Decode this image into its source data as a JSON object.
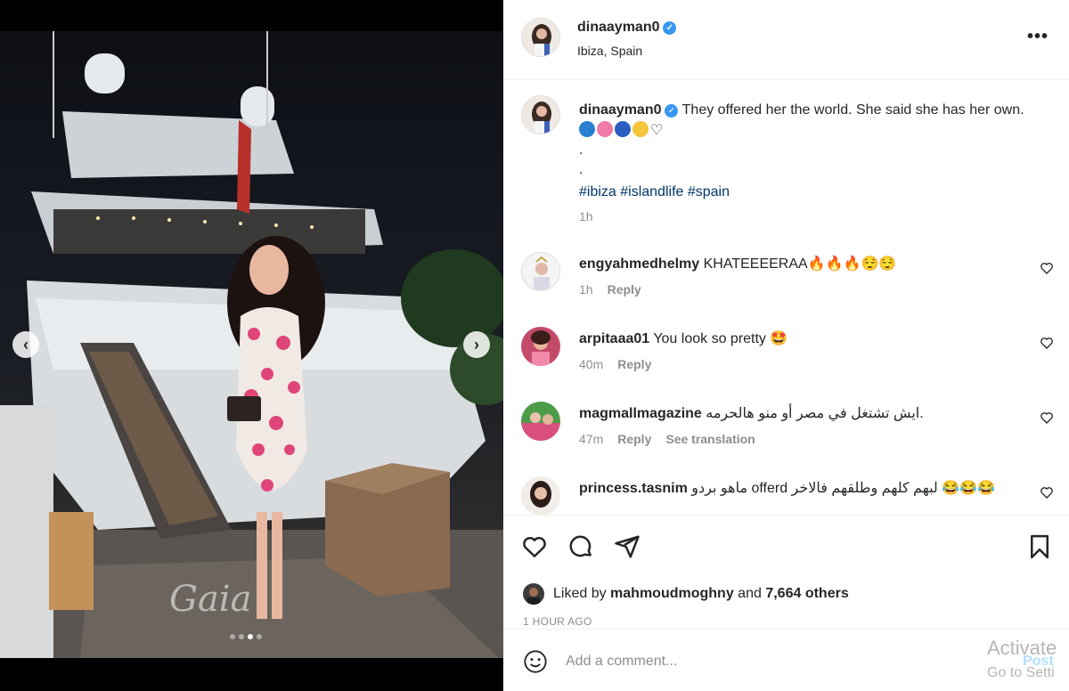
{
  "post": {
    "username": "dinaayman0",
    "location": "Ibiza, Spain",
    "more_label": "•••",
    "image_watermark": "Gaia"
  },
  "caption": {
    "username": "dinaayman0",
    "text": "They offered her the world. She said she has her own.",
    "dots": ".\n.",
    "hashtags": "#ibiza #islandlife #spain",
    "time": "1h"
  },
  "comments": [
    {
      "username": "engyahmedhelmy",
      "text": "KHATEEEERAA🔥🔥🔥😌😌",
      "time": "1h",
      "reply": "Reply",
      "translate": ""
    },
    {
      "username": "arpitaaa01",
      "text": "You look so pretty 🤩",
      "time": "40m",
      "reply": "Reply",
      "translate": ""
    },
    {
      "username": "magmallmagazine",
      "text": "ايش تشتغل في مصر أو منو هالحرمه.",
      "time": "47m",
      "reply": "Reply",
      "translate": "See translation"
    },
    {
      "username": "princess.tasnim",
      "text": "ماهو بردو offerd لبهم كلهم وطلقهم فالاخر 😂😂😂",
      "time": "",
      "reply": "",
      "translate": ""
    }
  ],
  "likes": {
    "prefix": "Liked by",
    "user": "mahmoudmoghny",
    "and": "and",
    "others": "7,664 others"
  },
  "timestamp": "1 HOUR AGO",
  "comment_box": {
    "placeholder": "Add a comment...",
    "post_label": "Post"
  },
  "watermark": {
    "line1": "Activate",
    "line2": "Go to Setti"
  },
  "carousel": {
    "slide_count": 4,
    "active_index": 2
  },
  "icons": [
    "chevron-left-icon",
    "chevron-right-icon",
    "more-icon",
    "verified-icon",
    "heart-icon",
    "comment-icon",
    "share-icon",
    "bookmark-icon",
    "emoji-icon"
  ],
  "colors": {
    "link": "#00376b",
    "verified": "#3897f0",
    "post_button": "#b2dffc",
    "muted": "#8e8e8e"
  }
}
